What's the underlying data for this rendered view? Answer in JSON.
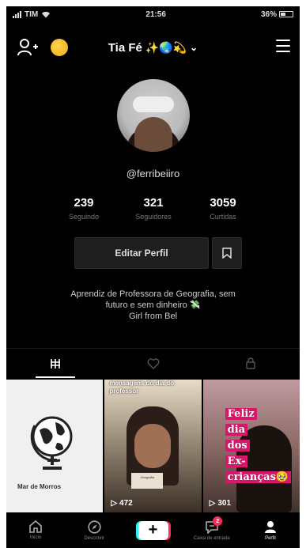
{
  "status_bar": {
    "carrier": "TIM",
    "time": "21:56",
    "battery": "36%"
  },
  "header": {
    "username": "Tia Fé",
    "username_emojis": "✨🌏💫",
    "add_user_icon": "add-user-icon",
    "coin_icon": "coin-icon",
    "menu_icon": "hamburger-icon"
  },
  "profile": {
    "handle": "@ferribeiiro",
    "stats": [
      {
        "value": "239",
        "label": "Seguindo"
      },
      {
        "value": "321",
        "label": "Seguidores"
      },
      {
        "value": "3059",
        "label": "Curtidas"
      }
    ],
    "edit_button": "Editar Perfil",
    "bio_lines": [
      "Aprendiz de Professora de Geografia, sem",
      "futuro e sem dinheiro 💸",
      "Girl from Bel"
    ]
  },
  "tabs": [
    {
      "icon": "grid-icon",
      "active": true
    },
    {
      "icon": "liked-icon",
      "active": false
    },
    {
      "icon": "lock-icon",
      "active": false
    }
  ],
  "videos": [
    {
      "title": "Mar de Morros",
      "subtitle": "",
      "views": ""
    },
    {
      "caption": "mensagens do dia do professor",
      "book_text": "Geografia",
      "views": "472"
    },
    {
      "overlay_lines": [
        "Feliz",
        "dia",
        "dos",
        "Ex-",
        "crianças🥹"
      ],
      "views": "301"
    }
  ],
  "bottom_nav": [
    {
      "label": "Início",
      "icon": "home-icon"
    },
    {
      "label": "Descobrir",
      "icon": "compass-icon"
    },
    {
      "label": "",
      "icon": "plus-icon"
    },
    {
      "label": "Caixa de entrada",
      "icon": "inbox-icon",
      "badge": "2"
    },
    {
      "label": "Perfil",
      "icon": "profile-icon",
      "active": true
    }
  ]
}
